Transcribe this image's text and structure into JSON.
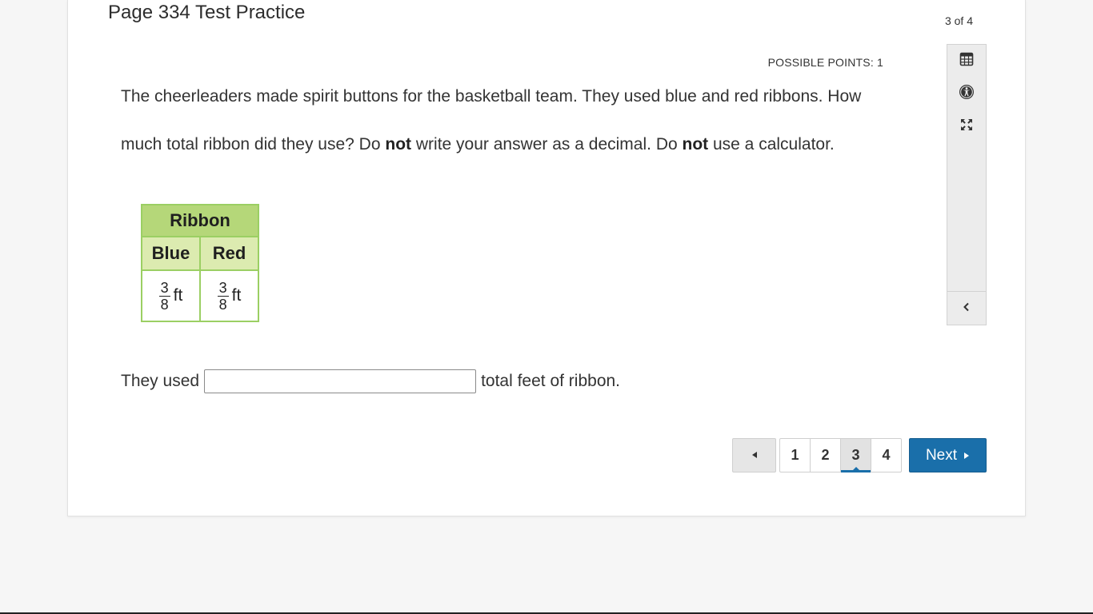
{
  "header": {
    "title": "Page 334 Test Practice",
    "progress": "3 of 4"
  },
  "question": {
    "points_label": "POSSIBLE POINTS: 1",
    "text_part1": "The cheerleaders made spirit buttons for the basketball team. They used blue and red ribbons. How much total ribbon did they use? Do ",
    "bold1": "not",
    "text_part2": " write your answer as a decimal. Do ",
    "bold2": "not",
    "text_part3": " use a calculator."
  },
  "ribbon_table": {
    "title": "Ribbon",
    "columns": [
      "Blue",
      "Red"
    ],
    "values": [
      {
        "numerator": "3",
        "denominator": "8",
        "unit": "ft"
      },
      {
        "numerator": "3",
        "denominator": "8",
        "unit": "ft"
      }
    ]
  },
  "answer": {
    "prefix": "They used",
    "value": "",
    "placeholder": "",
    "suffix": "total feet of ribbon."
  },
  "tools": {
    "icons": [
      "calculator-icon",
      "accessibility-icon",
      "fullscreen-icon",
      "collapse-chevron-icon"
    ]
  },
  "pagination": {
    "pages": [
      "1",
      "2",
      "3",
      "4"
    ],
    "current": "3",
    "next_label": "Next"
  },
  "colors": {
    "accent": "#1a6faa",
    "table_border": "#9bcf63",
    "table_header": "#b5d779",
    "table_subheader": "#dcebb0"
  }
}
